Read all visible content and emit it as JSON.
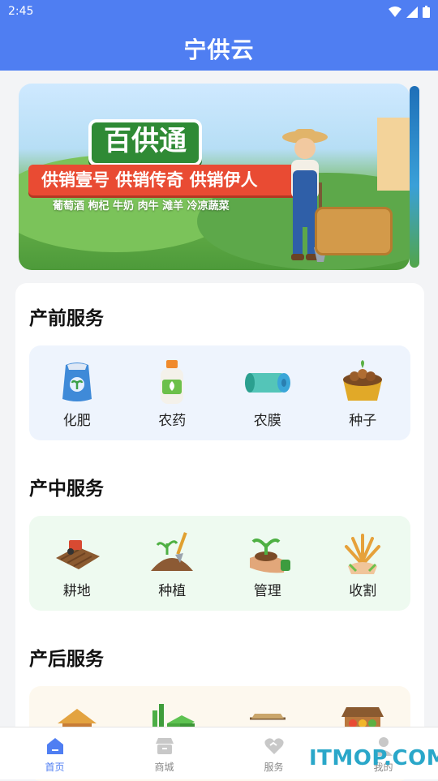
{
  "status_bar": {
    "time": "2:45"
  },
  "header": {
    "title": "宁供云"
  },
  "banner": {
    "logo_text": "百供通",
    "slogan": "供销壹号 供销传奇 供销伊人",
    "products": "葡萄酒 枸杞 牛奶 肉牛 滩羊 冷凉蔬菜"
  },
  "sections": [
    {
      "title": "产前服务",
      "items": [
        {
          "label": "化肥",
          "icon": "fertilizer-bag-icon"
        },
        {
          "label": "农药",
          "icon": "pesticide-bottle-icon"
        },
        {
          "label": "农膜",
          "icon": "agricultural-film-icon"
        },
        {
          "label": "种子",
          "icon": "seed-basket-icon"
        }
      ]
    },
    {
      "title": "产中服务",
      "items": [
        {
          "label": "耕地",
          "icon": "plowing-icon"
        },
        {
          "label": "种植",
          "icon": "planting-icon"
        },
        {
          "label": "管理",
          "icon": "seedling-hand-icon"
        },
        {
          "label": "收割",
          "icon": "wheat-harvest-icon"
        }
      ]
    },
    {
      "title": "产后服务",
      "items": [
        {
          "label": "",
          "icon": "haystack-icon"
        },
        {
          "label": "",
          "icon": "bamboo-crate-icon"
        },
        {
          "label": "",
          "icon": "grain-pile-icon"
        },
        {
          "label": "",
          "icon": "market-stall-icon"
        }
      ]
    }
  ],
  "bottom_nav": [
    {
      "label": "首页",
      "icon": "home-icon",
      "active": true
    },
    {
      "label": "商城",
      "icon": "store-icon",
      "active": false
    },
    {
      "label": "服务",
      "icon": "heart-service-icon",
      "active": false
    },
    {
      "label": "我的",
      "icon": "user-icon",
      "active": false
    }
  ],
  "watermark": "ITMOP.COM",
  "colors": {
    "primary": "#4f7ef2",
    "nav_inactive": "#888888"
  }
}
